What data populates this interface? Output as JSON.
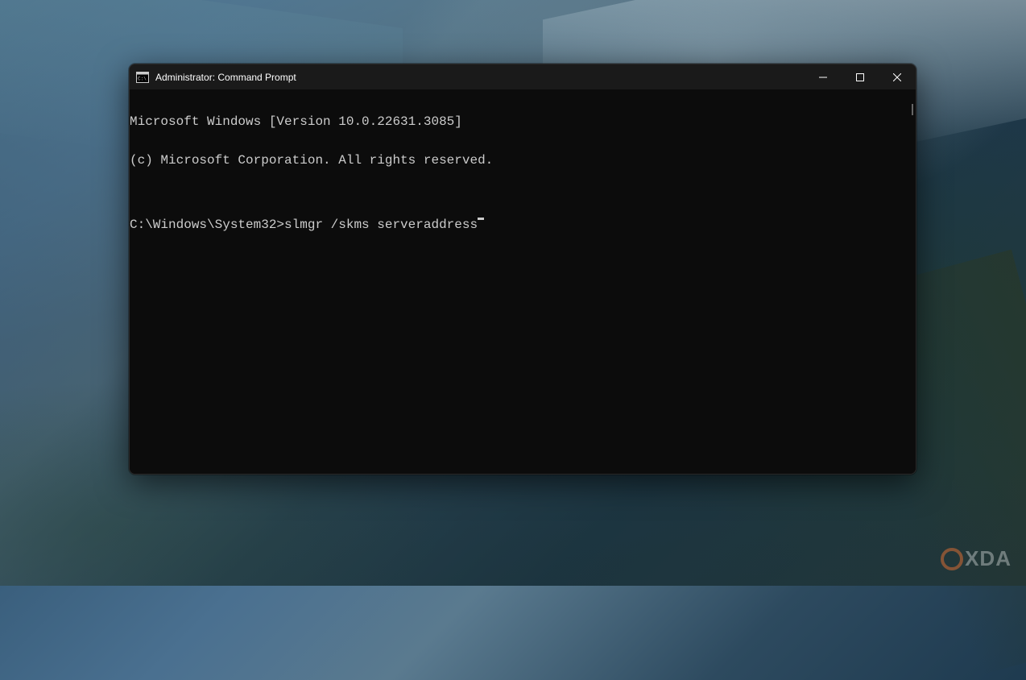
{
  "window": {
    "title": "Administrator: Command Prompt"
  },
  "terminal": {
    "line1": "Microsoft Windows [Version 10.0.22631.3085]",
    "line2": "(c) Microsoft Corporation. All rights reserved.",
    "blank": "",
    "prompt": "C:\\Windows\\System32>",
    "command": "slmgr /skms serveraddress"
  },
  "watermark": {
    "text": "XDA"
  },
  "icons": {
    "cmd": "cmd-icon",
    "minimize": "minimize-icon",
    "maximize": "maximize-icon",
    "close": "close-icon"
  }
}
